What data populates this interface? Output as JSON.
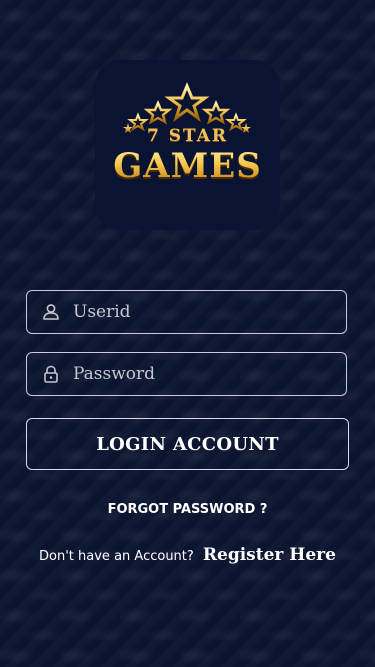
{
  "logo": {
    "line1": "7 STAR",
    "line2": "GAMES",
    "stars_icon": "stars-icon"
  },
  "form": {
    "userid": {
      "placeholder": "Userid",
      "value": "",
      "icon": "user-icon"
    },
    "password": {
      "placeholder": "Password",
      "value": "",
      "icon": "lock-icon"
    },
    "login_label": "LOGIN ACCOUNT"
  },
  "links": {
    "forgot_password": "FORGOT PASSWORD ?",
    "register_prompt": "Don't have an Account?",
    "register_link": "Register Here"
  },
  "colors": {
    "background": "#0c1530",
    "logo_box": "#0a1331",
    "gold": "#f5c24a",
    "border": "#c9ccd6",
    "text": "#ffffff"
  }
}
